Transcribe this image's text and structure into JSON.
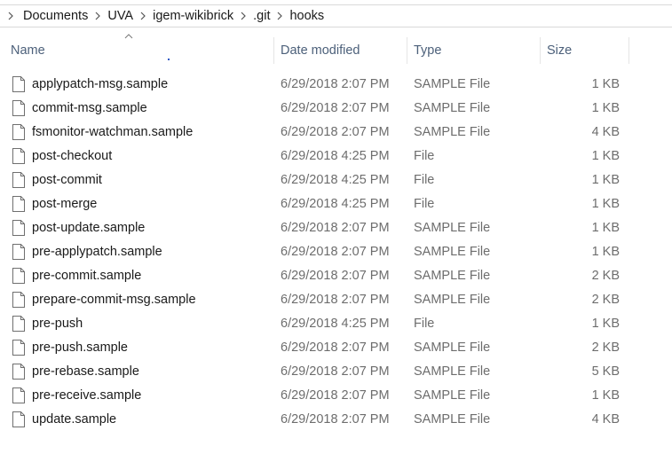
{
  "breadcrumb": [
    "Documents",
    "UVA",
    "igem-wikibrick",
    ".git",
    "hooks"
  ],
  "columns": {
    "name": "Name",
    "date": "Date modified",
    "type": "Type",
    "size": "Size"
  },
  "files": [
    {
      "name": "applypatch-msg.sample",
      "date": "6/29/2018 2:07 PM",
      "type": "SAMPLE File",
      "size": "1 KB"
    },
    {
      "name": "commit-msg.sample",
      "date": "6/29/2018 2:07 PM",
      "type": "SAMPLE File",
      "size": "1 KB"
    },
    {
      "name": "fsmonitor-watchman.sample",
      "date": "6/29/2018 2:07 PM",
      "type": "SAMPLE File",
      "size": "4 KB"
    },
    {
      "name": "post-checkout",
      "date": "6/29/2018 4:25 PM",
      "type": "File",
      "size": "1 KB"
    },
    {
      "name": "post-commit",
      "date": "6/29/2018 4:25 PM",
      "type": "File",
      "size": "1 KB"
    },
    {
      "name": "post-merge",
      "date": "6/29/2018 4:25 PM",
      "type": "File",
      "size": "1 KB"
    },
    {
      "name": "post-update.sample",
      "date": "6/29/2018 2:07 PM",
      "type": "SAMPLE File",
      "size": "1 KB"
    },
    {
      "name": "pre-applypatch.sample",
      "date": "6/29/2018 2:07 PM",
      "type": "SAMPLE File",
      "size": "1 KB"
    },
    {
      "name": "pre-commit.sample",
      "date": "6/29/2018 2:07 PM",
      "type": "SAMPLE File",
      "size": "2 KB"
    },
    {
      "name": "prepare-commit-msg.sample",
      "date": "6/29/2018 2:07 PM",
      "type": "SAMPLE File",
      "size": "2 KB"
    },
    {
      "name": "pre-push",
      "date": "6/29/2018 4:25 PM",
      "type": "File",
      "size": "1 KB"
    },
    {
      "name": "pre-push.sample",
      "date": "6/29/2018 2:07 PM",
      "type": "SAMPLE File",
      "size": "2 KB"
    },
    {
      "name": "pre-rebase.sample",
      "date": "6/29/2018 2:07 PM",
      "type": "SAMPLE File",
      "size": "5 KB"
    },
    {
      "name": "pre-receive.sample",
      "date": "6/29/2018 2:07 PM",
      "type": "SAMPLE File",
      "size": "1 KB"
    },
    {
      "name": "update.sample",
      "date": "6/29/2018 2:07 PM",
      "type": "SAMPLE File",
      "size": "4 KB"
    }
  ],
  "icons": {
    "separator": "chevron-right-icon",
    "sort": "sort-ascending-icon",
    "file": "file-icon"
  }
}
